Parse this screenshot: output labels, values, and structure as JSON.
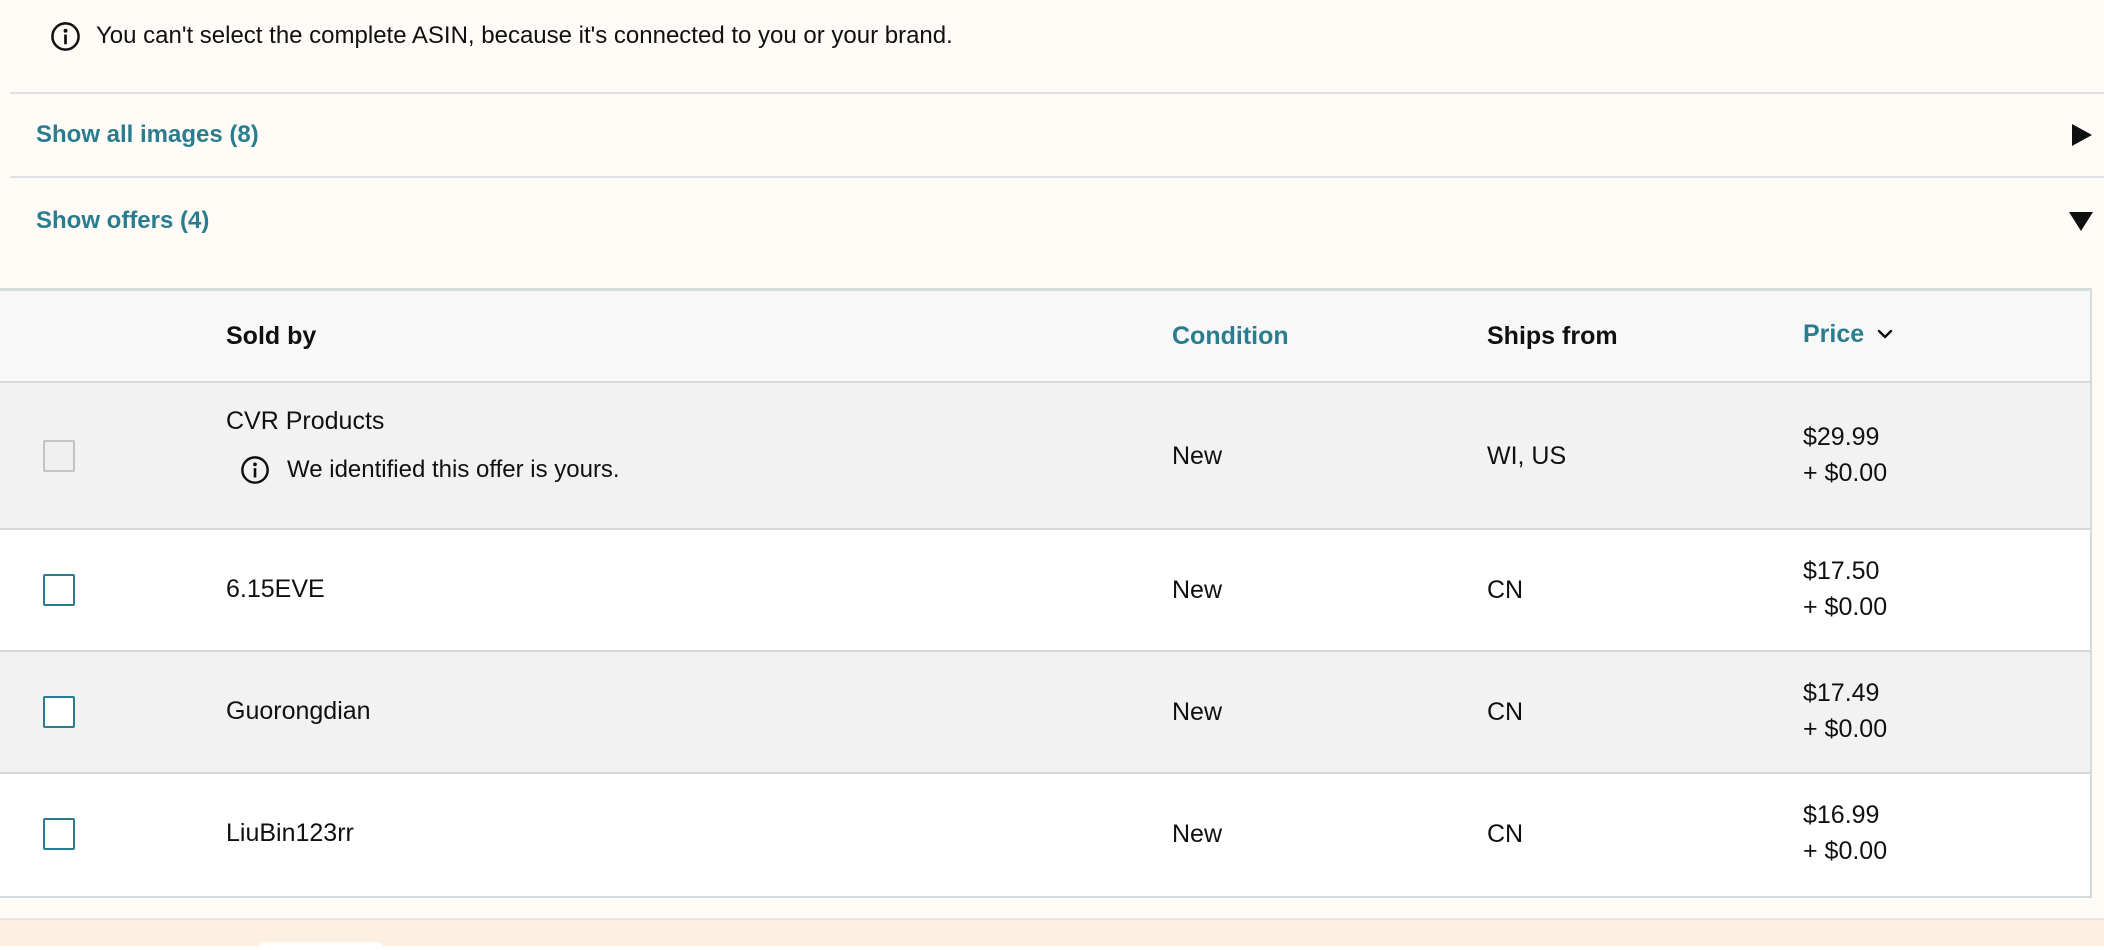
{
  "notice": {
    "icon": "info-icon",
    "text": "You can't select the complete ASIN, because it's connected to you or your brand."
  },
  "expanders": {
    "images": {
      "label": "Show all images (8)",
      "state": "collapsed"
    },
    "offers": {
      "label": "Show offers (4)",
      "state": "expanded"
    }
  },
  "table": {
    "headers": {
      "sold_by": "Sold by",
      "condition": "Condition",
      "ships_from": "Ships from",
      "price": "Price"
    },
    "rows": [
      {
        "seller": "CVR Products",
        "note": "We identified this offer is yours.",
        "condition": "New",
        "ships_from": "WI, US",
        "price": "$29.99",
        "shipping": "+ $0.00",
        "selectable": false
      },
      {
        "seller": "6.15EVE",
        "condition": "New",
        "ships_from": "CN",
        "price": "$17.50",
        "shipping": "+ $0.00",
        "selectable": true
      },
      {
        "seller": "Guorongdian",
        "condition": "New",
        "ships_from": "CN",
        "price": "$17.49",
        "shipping": "+ $0.00",
        "selectable": true
      },
      {
        "seller": "LiuBin123rr",
        "condition": "New",
        "ships_from": "CN",
        "price": "$16.99",
        "shipping": "+ $0.00",
        "selectable": true
      }
    ]
  },
  "colors": {
    "link": "#2a7d8f",
    "page_bg": "#fffbf7",
    "row_shaded": "#f2f2f2",
    "header_bg": "#f8f8f8"
  }
}
